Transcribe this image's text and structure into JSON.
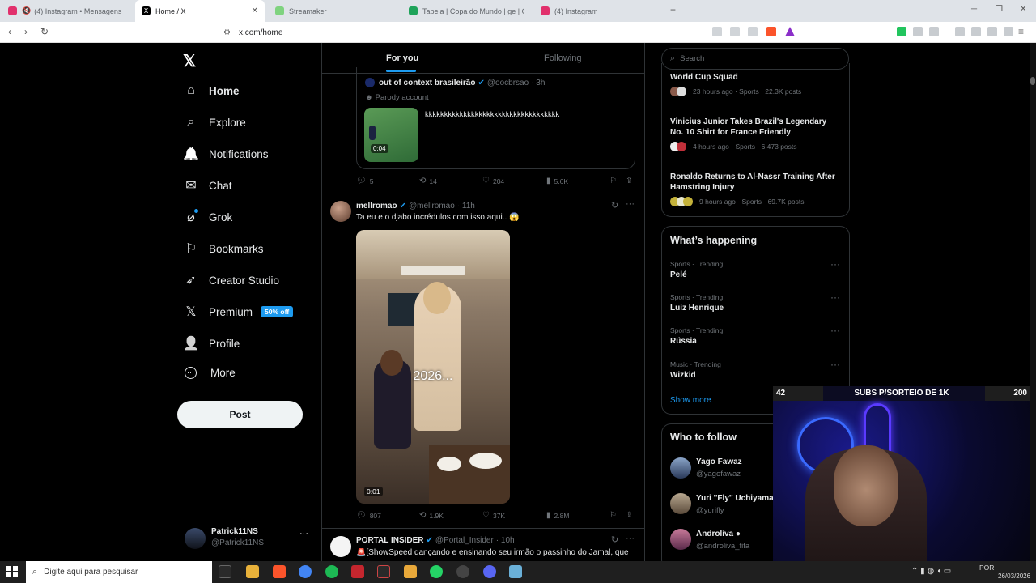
{
  "browser": {
    "tabs": [
      {
        "title": "(4) Instagram • Mensagens",
        "color": "#e1306c"
      },
      {
        "title": "Home / X",
        "color": "#000000"
      },
      {
        "title": "Streamaker",
        "color": "#7fd37f"
      },
      {
        "title": "Tabela | Copa do Mundo | ge | Copa do Mundo",
        "color": "#1fa35a"
      },
      {
        "title": "(4) Instagram",
        "color": "#e1306c"
      }
    ],
    "new_tab": "+",
    "url": "x.com/home"
  },
  "sidebar": {
    "items": [
      {
        "label": "Home",
        "icon": "home-icon",
        "glyph": "⌂"
      },
      {
        "label": "Explore",
        "icon": "search-icon",
        "glyph": "⌕"
      },
      {
        "label": "Notifications",
        "icon": "bell-icon",
        "glyph": "🔔"
      },
      {
        "label": "Chat",
        "icon": "mail-icon",
        "glyph": "✉"
      },
      {
        "label": "Grok",
        "icon": "grok-icon",
        "glyph": "⌀"
      },
      {
        "label": "Bookmarks",
        "icon": "bookmark-icon",
        "glyph": "⚐"
      },
      {
        "label": "Creator Studio",
        "icon": "rocket-icon",
        "glyph": "➶"
      },
      {
        "label": "Premium",
        "icon": "x-logo-icon",
        "glyph": "𝕏",
        "badge": "50% off"
      },
      {
        "label": "Profile",
        "icon": "person-icon",
        "glyph": "👤"
      },
      {
        "label": "More",
        "icon": "more-circle-icon",
        "glyph": "⋯"
      }
    ],
    "post_label": "Post",
    "account": {
      "name": "Patrick11NS",
      "handle": "@Patrick11NS",
      "more": "···"
    }
  },
  "timeline": {
    "tabs": [
      "For you",
      "Following"
    ],
    "tweet1": {
      "name": "out of context brasileirão",
      "handle": "@oocbrsao",
      "time": "· 3h",
      "label": "Parody account",
      "text": "kkkkkkkkkkkkkkkkkkkkkkkkkkkkkkkkkkk",
      "video_time": "0:04",
      "replies": "5",
      "reposts": "14",
      "likes": "204",
      "views": "5.6K"
    },
    "tweet2": {
      "name": "mellromao",
      "handle": "@mellromao",
      "time": "· 11h",
      "text": "Ta eu e o djabo incrédulos com isso aqui.. 😱",
      "video_caption": "2026...",
      "video_time": "0:01",
      "replies": "807",
      "reposts": "1.9K",
      "likes": "37K",
      "views": "2.8M"
    },
    "tweet3": {
      "name": "PORTAL INSIDER",
      "handle": "@Portal_Insider",
      "time": "· 10h",
      "text": "🚨[ShowSpeed dançando e ensinando seu irmão o passinho do Jamal, que"
    }
  },
  "right": {
    "search_placeholder": "Search",
    "news": [
      {
        "title": "World Cup Squad",
        "meta": "23 hours ago · Sports · 22.3K posts"
      },
      {
        "title": "Vinicius Junior Takes Brazil's Legendary No. 10 Shirt for France Friendly",
        "meta": "4 hours ago · Sports · 6,473 posts"
      },
      {
        "title": "Ronaldo Returns to Al-Nassr Training After Hamstring Injury",
        "meta": "9 hours ago · Sports · 69.7K posts"
      }
    ],
    "happening_title": "What’s happening",
    "trends": [
      {
        "cat": "Sports · Trending",
        "name": "Pelé"
      },
      {
        "cat": "Sports · Trending",
        "name": "Luiz Henrique"
      },
      {
        "cat": "Sports · Trending",
        "name": "Rússia"
      },
      {
        "cat": "Music · Trending",
        "name": "Wizkid"
      }
    ],
    "show_more": "Show more",
    "who_title": "Who to follow",
    "follow": [
      {
        "name": "Yago Fawaz",
        "handle": "@yagofawaz"
      },
      {
        "name": "Yuri ''Fly'' Uchiyama",
        "handle": "@yurifly"
      },
      {
        "name": "Androliva ●",
        "handle": "@androliva_fifa"
      }
    ]
  },
  "overlay": {
    "left": "42",
    "center": "SUBS P/SORTEIO DE 1K",
    "right": "200"
  },
  "taskbar": {
    "search": "Digite aqui para pesquisar",
    "lang": "POR",
    "date": "26/03/2026"
  }
}
